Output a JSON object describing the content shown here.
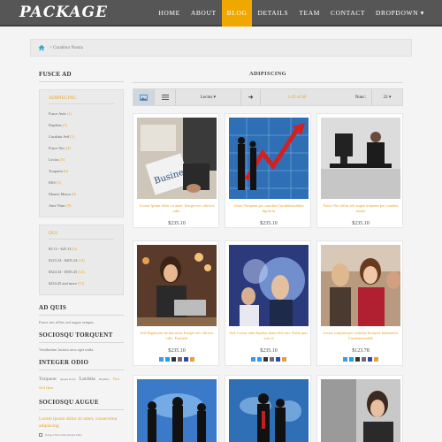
{
  "header": {
    "logo": "PACKAGE",
    "nav": [
      {
        "label": "HOME",
        "active": false
      },
      {
        "label": "ABOUT",
        "active": false
      },
      {
        "label": "BLOG",
        "active": true
      },
      {
        "label": "DETAILS",
        "active": false
      },
      {
        "label": "TEAM",
        "active": false
      },
      {
        "label": "CONTACT",
        "active": false
      },
      {
        "label": "DROPDOWN ▾",
        "active": false
      }
    ]
  },
  "breadcrumb": {
    "current": "> Curabitur Nostra"
  },
  "sidebar": {
    "fusce_title": "FUSCE AD",
    "categories_title": "ADIPISCING",
    "categories": [
      {
        "label": "Fusce Ante",
        "count": "(1)"
      },
      {
        "label": "Dapibus",
        "count": "(1)"
      },
      {
        "label": "Curabitu Sed",
        "count": "(1)"
      },
      {
        "label": "Fusce Nec",
        "count": "(4)"
      },
      {
        "label": "Lectus",
        "count": "(3)"
      },
      {
        "label": "Torquent",
        "count": "(6)"
      },
      {
        "label": "RSS",
        "count": "(5)"
      },
      {
        "label": "Mauris Massa",
        "count": "(8)"
      },
      {
        "label": "Ante Nunc",
        "count": "(9)"
      }
    ],
    "price_title": "DUI",
    "prices": [
      {
        "label": "$3.12 - $25.14",
        "count": "(5)"
      },
      {
        "label": "$123.34 - $405.34",
        "count": "(14)"
      },
      {
        "label": "$324.34 - $585.45",
        "count": "(12)"
      },
      {
        "label": "$234.45 and more",
        "count": "(17)"
      }
    ],
    "ad_quis_title": "AD QUIS",
    "ad_quis_text": "Fusce nec tellus sed augue semper.",
    "torquent_title": "SOCIOSQU TORQUENT",
    "torquent_text": "Vestibulum lacinia arcu eget nulla.",
    "odio_title": "INTEGER ODIO",
    "tags": [
      "Torquent",
      "Augue Porta",
      "Lacinia",
      "Dapibus",
      "Nisi Sed Quis"
    ],
    "auge_title": "SOCIOSQU AUGUE",
    "auge_text": "Lorem ipsum dolor sit amet, consectetur adipiscing",
    "auge_row": "Integer Nisi Odio Ipsum Odio"
  },
  "main": {
    "title": "ADIPISCING",
    "toolbar": {
      "sort": "Lectus ▾",
      "arrow": "➜",
      "range": "1-22 of 40",
      "num_label": "Nunc:",
      "count": "22 ▾"
    },
    "products": [
      {
        "name": "Lorem Ipsum dolor sit amet. Integer nec ultrices odio.",
        "price": "$235.10"
      },
      {
        "name": "Leotu Torquent per conubia Curabitmosdulot ligula in",
        "price": "$235.10"
      },
      {
        "name": "Fusce Nec tellus sed augue torquent per conubia nostra",
        "price": "$235.10"
      },
      {
        "name": "Sed Dignissim lacinia nunc Integer nec ultrices odio. Praesent",
        "price": "$235.10"
      },
      {
        "name": "Sed Cursus ante dapibus diam Sed nisi. Nulla quis sem at",
        "price": "$235.10"
      },
      {
        "name": "Lectus torquent per conubia Inceptos himenaeos Curabitmosdule",
        "price": "$123.78"
      },
      {
        "name": "",
        "price": ""
      },
      {
        "name": "",
        "price": ""
      },
      {
        "name": "",
        "price": ""
      }
    ]
  },
  "colors": {
    "accent": "#f0a800",
    "header_bg": "#565656",
    "icon_colors": [
      "#3d9be9",
      "#1da1f2",
      "#333333",
      "#6d6d6d",
      "#2b4ba8",
      "#e7a03a"
    ]
  }
}
